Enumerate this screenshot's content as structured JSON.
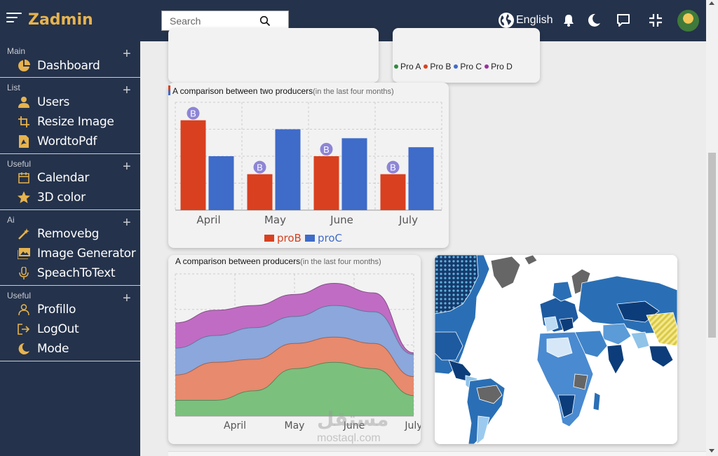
{
  "brand": "Zadmin",
  "search": {
    "placeholder": "Search"
  },
  "topbar": {
    "language": "English"
  },
  "sidebar": {
    "sections": [
      {
        "title": "Main",
        "items": [
          {
            "label": "Dashboard",
            "icon": "pie-chart-icon"
          }
        ]
      },
      {
        "title": "List",
        "items": [
          {
            "label": "Users",
            "icon": "user-icon"
          },
          {
            "label": "Resize Image",
            "icon": "crop-icon"
          },
          {
            "label": "WordtoPdf",
            "icon": "pdf-icon"
          }
        ]
      },
      {
        "title": "Useful",
        "items": [
          {
            "label": "Calendar",
            "icon": "calendar-icon"
          },
          {
            "label": "3D color",
            "icon": "star-icon"
          }
        ]
      },
      {
        "title": "Ai",
        "items": [
          {
            "label": "Removebg",
            "icon": "magic-wand-icon"
          },
          {
            "label": "Image Generator",
            "icon": "image-icon"
          },
          {
            "label": "SpeachToText",
            "icon": "microphone-icon"
          }
        ]
      },
      {
        "title": "Useful",
        "items": [
          {
            "label": "Profillo",
            "icon": "person-icon"
          },
          {
            "label": "LogOut",
            "icon": "logout-icon"
          },
          {
            "label": "Mode",
            "icon": "moon-icon"
          }
        ]
      }
    ]
  },
  "top_legend": [
    {
      "label": "Pro A",
      "color": "#2e8b3e"
    },
    {
      "label": "Pro B",
      "color": "#d9401f"
    },
    {
      "label": "Pro C",
      "color": "#3f6bc9"
    },
    {
      "label": "Pro D",
      "color": "#9b2fa0"
    }
  ],
  "bar_card": {
    "title": "A comparison between two producers",
    "subtitle": "(in the last four months)",
    "badge": "B"
  },
  "area_card": {
    "title": "A comparison between producers",
    "subtitle": "(in the last four months)"
  },
  "watermark": {
    "text": "مستقل",
    "sub": "mostaql.com"
  },
  "colors": {
    "topbar": "#24324b",
    "brand": "#e7b34d",
    "proB": "#d9401f",
    "proC": "#3f6bc9",
    "badge": "#8d85d6"
  },
  "chart_data": [
    {
      "type": "bar",
      "title": "A comparison between two producers",
      "subtitle": "(in the last four months)",
      "categories": [
        "April",
        "May",
        "June",
        "July"
      ],
      "series": [
        {
          "name": "proB",
          "values": [
            10,
            4,
            6,
            4
          ],
          "color": "#d9401f"
        },
        {
          "name": "proC",
          "values": [
            6,
            9,
            8,
            7
          ],
          "color": "#3f6bc9"
        }
      ],
      "ylim": [
        0,
        12
      ],
      "grid": true,
      "legend": "bottom"
    },
    {
      "type": "area",
      "title": "A comparison between producers",
      "subtitle": "(in the last four months)",
      "categories": [
        "",
        "April",
        "May",
        "June",
        "July"
      ],
      "series": [
        {
          "name": "Pro A",
          "values": [
            1.0,
            1.0,
            1.6,
            3.0,
            3.4,
            3.0,
            1.3
          ],
          "color": "#7cc07e"
        },
        {
          "name": "Pro B",
          "values": [
            1.6,
            2.4,
            2.0,
            1.6,
            1.6,
            1.6,
            1.2
          ],
          "color": "#e78a6e"
        },
        {
          "name": "Pro C",
          "values": [
            1.7,
            1.7,
            2.0,
            1.7,
            2.0,
            2.0,
            1.4
          ],
          "color": "#8ba7dc"
        },
        {
          "name": "Pro D",
          "values": [
            1.6,
            1.6,
            1.4,
            1.4,
            1.4,
            1.2,
            0.1
          ],
          "color": "#c06cc4"
        }
      ],
      "ylim": [
        0,
        9
      ],
      "grid": true,
      "legend": "none"
    }
  ]
}
